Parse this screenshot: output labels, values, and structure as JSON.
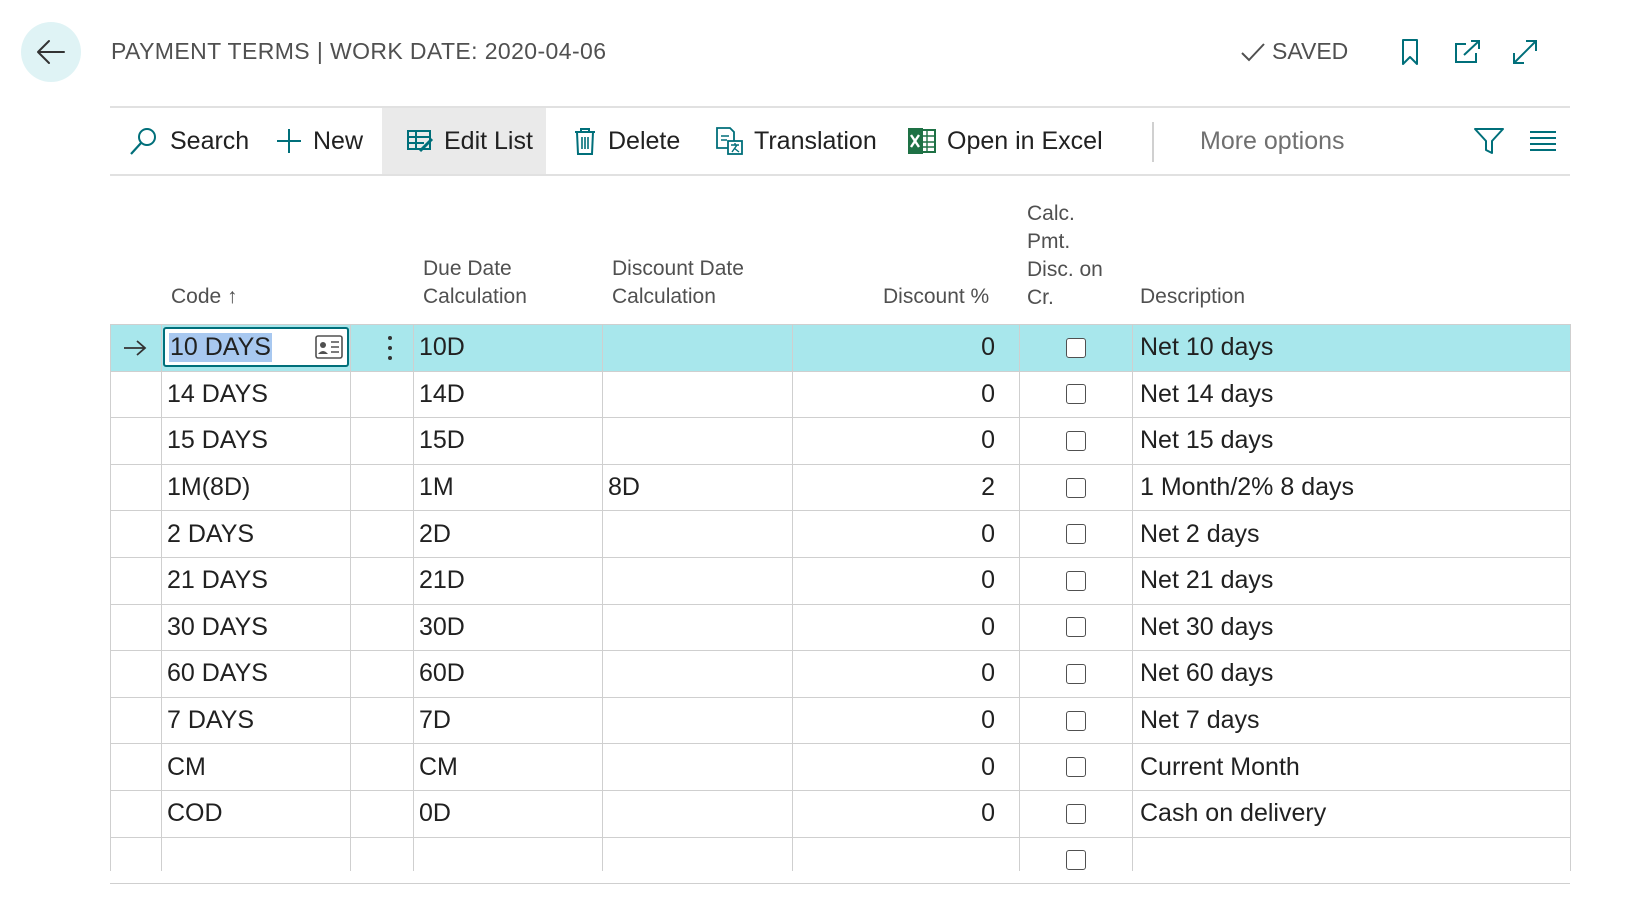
{
  "header": {
    "title": "PAYMENT TERMS | WORK DATE: 2020-04-06",
    "saved_label": "SAVED"
  },
  "actions": {
    "search": "Search",
    "new": "New",
    "edit_list": "Edit List",
    "delete": "Delete",
    "translation": "Translation",
    "open_in_excel": "Open in Excel",
    "more_options": "More options"
  },
  "columns": {
    "code": "Code",
    "due_date_1": "Due Date",
    "due_date_2": "Calculation",
    "discount_date_1": "Discount Date",
    "discount_date_2": "Calculation",
    "discount_pct": "Discount %",
    "calc_1": "Calc.",
    "calc_2": "Pmt.",
    "calc_3": "Disc. on",
    "calc_4": "Cr.",
    "description": "Description"
  },
  "rows": [
    {
      "code": "10 DAYS",
      "due": "10D",
      "disc_date": "",
      "disc_pct": "0",
      "desc": "Net 10 days"
    },
    {
      "code": "14 DAYS",
      "due": "14D",
      "disc_date": "",
      "disc_pct": "0",
      "desc": "Net 14 days"
    },
    {
      "code": "15 DAYS",
      "due": "15D",
      "disc_date": "",
      "disc_pct": "0",
      "desc": "Net 15 days"
    },
    {
      "code": "1M(8D)",
      "due": "1M",
      "disc_date": "8D",
      "disc_pct": "2",
      "desc": "1 Month/2% 8 days"
    },
    {
      "code": "2 DAYS",
      "due": "2D",
      "disc_date": "",
      "disc_pct": "0",
      "desc": "Net 2 days"
    },
    {
      "code": "21 DAYS",
      "due": "21D",
      "disc_date": "",
      "disc_pct": "0",
      "desc": "Net 21 days"
    },
    {
      "code": "30 DAYS",
      "due": "30D",
      "disc_date": "",
      "disc_pct": "0",
      "desc": "Net 30 days"
    },
    {
      "code": "60 DAYS",
      "due": "60D",
      "disc_date": "",
      "disc_pct": "0",
      "desc": "Net 60 days"
    },
    {
      "code": "7 DAYS",
      "due": "7D",
      "disc_date": "",
      "disc_pct": "0",
      "desc": "Net 7 days"
    },
    {
      "code": "CM",
      "due": "CM",
      "disc_date": "",
      "disc_pct": "0",
      "desc": "Current Month"
    },
    {
      "code": "COD",
      "due": "0D",
      "disc_date": "",
      "disc_pct": "0",
      "desc": "Cash on delivery"
    },
    {
      "code": "",
      "due": "",
      "disc_date": "",
      "disc_pct": "",
      "desc": ""
    }
  ],
  "colors": {
    "accent": "#006f7a",
    "selected_row": "#a8e7ec",
    "back_button_bg": "#dff3f5",
    "excel_green": "#1e7145"
  }
}
